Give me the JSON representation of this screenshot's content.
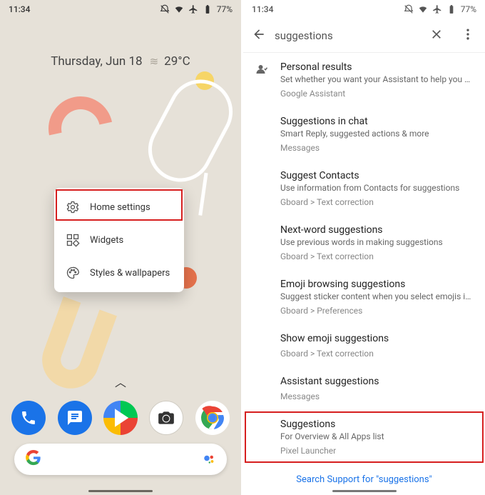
{
  "status": {
    "time": "11:34",
    "battery": "77%"
  },
  "home": {
    "date": "Thursday, Jun 18",
    "temp": "29°C",
    "popup": {
      "home_settings": "Home settings",
      "widgets": "Widgets",
      "styles": "Styles & wallpapers"
    }
  },
  "search": {
    "query": "suggestions",
    "results": [
      {
        "title": "Personal results",
        "subtitle": "Set whether you want your Assistant to help you with y…",
        "breadcrumb": "Google Assistant",
        "icon": true
      },
      {
        "title": "Suggestions in chat",
        "subtitle": "Smart Reply, suggested actions & more",
        "breadcrumb": "Messages",
        "icon": false
      },
      {
        "title": "Suggest Contacts",
        "subtitle": "Use information from Contacts for suggestions",
        "breadcrumb": "Gboard > Text correction",
        "icon": false
      },
      {
        "title": "Next-word suggestions",
        "subtitle": "Use previous words in making suggestions",
        "breadcrumb": "Gboard > Text correction",
        "icon": false
      },
      {
        "title": "Emoji browsing suggestions",
        "subtitle": "Suggest sticker content when you select emojis in the…",
        "breadcrumb": "Gboard > Preferences",
        "icon": false
      },
      {
        "title": "Show emoji suggestions",
        "subtitle": "",
        "breadcrumb": "Gboard > Text correction",
        "icon": false
      },
      {
        "title": "Assistant suggestions",
        "subtitle": "",
        "breadcrumb": "Messages",
        "icon": false
      },
      {
        "title": "Suggestions",
        "subtitle": "For Overview & All Apps list",
        "breadcrumb": "Pixel Launcher",
        "icon": false,
        "highlight": true
      }
    ],
    "support": "Search Support for \"suggestions\""
  }
}
